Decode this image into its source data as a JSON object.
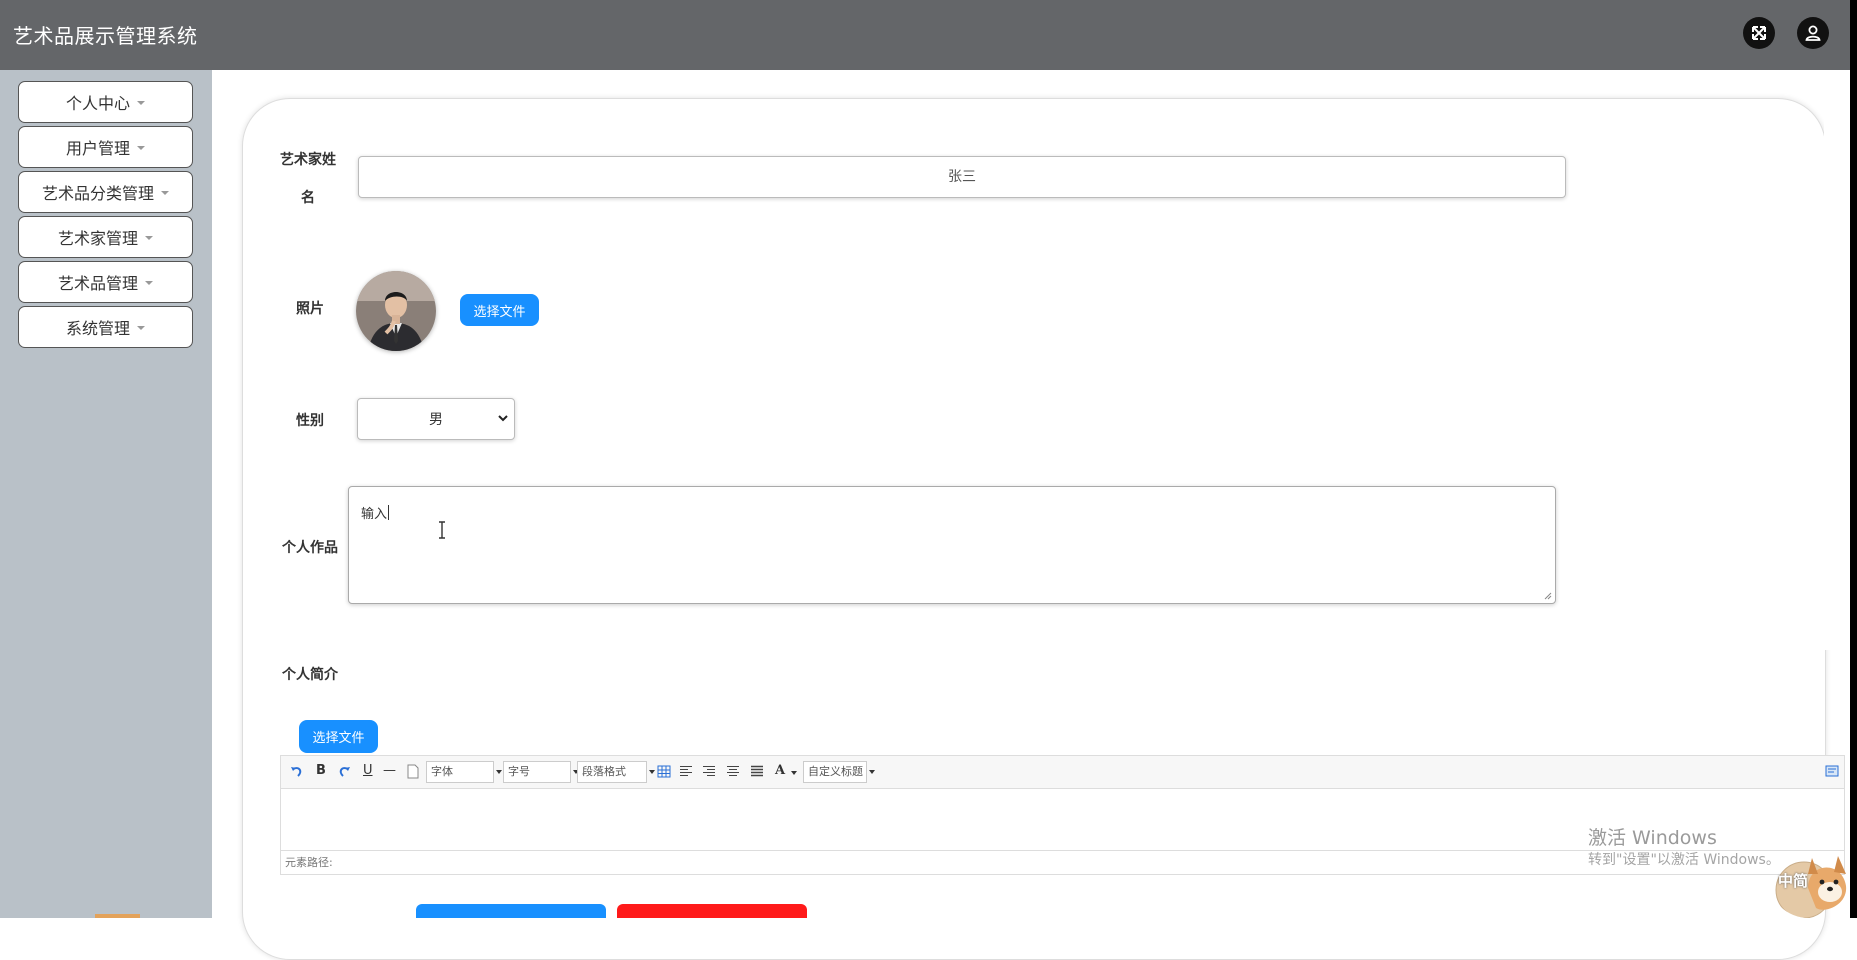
{
  "app": {
    "title": "艺术品展示管理系统"
  },
  "header": {
    "fullscreen_icon": "expand-icon",
    "user_icon": "user-icon"
  },
  "sidebar": {
    "items": [
      {
        "label": "个人中心"
      },
      {
        "label": "用户管理"
      },
      {
        "label": "艺术品分类管理"
      },
      {
        "label": "艺术家管理"
      },
      {
        "label": "艺术品管理"
      },
      {
        "label": "系统管理"
      }
    ]
  },
  "form": {
    "name_label_line1": "艺术家姓",
    "name_label_line2": "名",
    "name_value": "张三",
    "photo_label": "照片",
    "photo_button": "选择文件",
    "gender_label": "性别",
    "gender_value": "男",
    "works_label": "个人作品",
    "works_value": "输入",
    "intro_label": "个人简介",
    "intro_button": "选择文件"
  },
  "editor": {
    "font_select": "字体",
    "size_select": "字号",
    "paragraph_select": "段落格式",
    "custom_title_select": "自定义标题",
    "path_label": "元素路径:"
  },
  "watermark": {
    "line1": "激活 Windows",
    "line2": "转到\"设置\"以激活 Windows。"
  },
  "ime_badge": "中简",
  "colors": {
    "header": "#646669",
    "sidebar": "#b9c1c8",
    "primary": "#1890ff",
    "danger": "#ff2a2a"
  }
}
